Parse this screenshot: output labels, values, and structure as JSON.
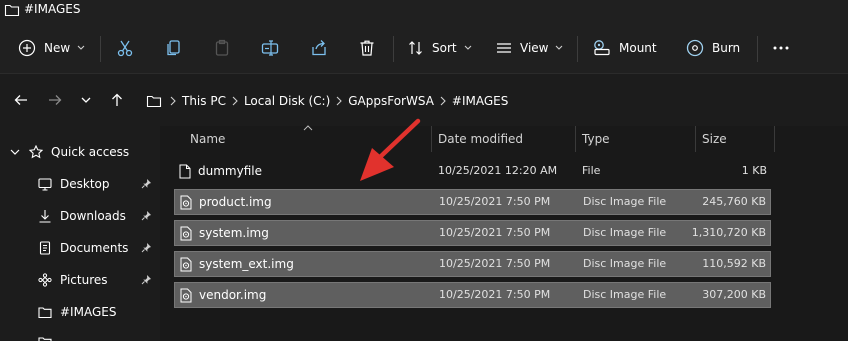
{
  "window": {
    "title": "#IMAGES"
  },
  "toolbar": {
    "new_label": "New",
    "sort_label": "Sort",
    "view_label": "View",
    "mount_label": "Mount",
    "burn_label": "Burn"
  },
  "breadcrumb": [
    "This PC",
    "Local Disk (C:)",
    "GAppsForWSA",
    "#IMAGES"
  ],
  "sidebar": {
    "quick_access": "Quick access",
    "items": [
      {
        "label": "Desktop",
        "icon": "desktop-icon",
        "pinned": true
      },
      {
        "label": "Downloads",
        "icon": "download-icon",
        "pinned": true
      },
      {
        "label": "Documents",
        "icon": "document-icon",
        "pinned": true
      },
      {
        "label": "Pictures",
        "icon": "pictures-icon",
        "pinned": true
      },
      {
        "label": "#IMAGES",
        "icon": "folder-icon",
        "pinned": false
      }
    ]
  },
  "columns": {
    "name": "Name",
    "date": "Date modified",
    "type": "Type",
    "size": "Size"
  },
  "files": [
    {
      "name": "dummyfile",
      "date": "10/25/2021 12:20 AM",
      "type": "File",
      "size": "1 KB",
      "selected": false,
      "icon": "file-icon"
    },
    {
      "name": "product.img",
      "date": "10/25/2021 7:50 PM",
      "type": "Disc Image File",
      "size": "245,760 KB",
      "selected": true,
      "icon": "disc-image-icon"
    },
    {
      "name": "system.img",
      "date": "10/25/2021 7:50 PM",
      "type": "Disc Image File",
      "size": "1,310,720 KB",
      "selected": true,
      "icon": "disc-image-icon"
    },
    {
      "name": "system_ext.img",
      "date": "10/25/2021 7:50 PM",
      "type": "Disc Image File",
      "size": "110,592 KB",
      "selected": true,
      "icon": "disc-image-icon"
    },
    {
      "name": "vendor.img",
      "date": "10/25/2021 7:50 PM",
      "type": "Disc Image File",
      "size": "307,200 KB",
      "selected": true,
      "icon": "disc-image-icon"
    }
  ],
  "colors": {
    "selection": "#5f5f5f",
    "accent_arrow": "#e1322d",
    "burn_icon": "#9fd1f0"
  }
}
